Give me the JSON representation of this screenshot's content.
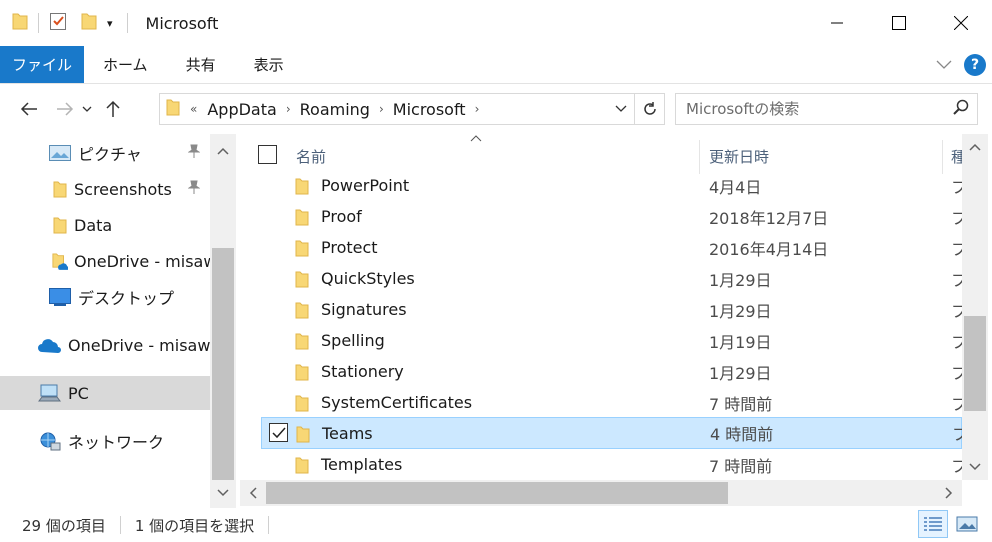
{
  "window": {
    "title": "Microsoft"
  },
  "ribbon": {
    "tabs": [
      "ファイル",
      "ホーム",
      "共有",
      "表示"
    ],
    "help_label": "?"
  },
  "address": {
    "overflow_marker": "«",
    "crumbs": [
      "AppData",
      "Roaming",
      "Microsoft"
    ]
  },
  "search": {
    "placeholder": "Microsoftの検索"
  },
  "nav": {
    "items": [
      {
        "label": "ピクチャ",
        "icon": "pictures-icon",
        "pinned": true
      },
      {
        "label": "Screenshots",
        "icon": "folder-icon",
        "pinned": true
      },
      {
        "label": "Data",
        "icon": "folder-icon",
        "pinned": false
      },
      {
        "label": "OneDrive - misawa",
        "icon": "onedrive-folder-icon",
        "pinned": false
      },
      {
        "label": "デスクトップ",
        "icon": "desktop-icon",
        "pinned": false
      },
      {
        "label": "OneDrive - misawa",
        "icon": "onedrive-cloud-icon",
        "pinned": false
      },
      {
        "label": "PC",
        "icon": "pc-icon",
        "pinned": false,
        "selected": true
      },
      {
        "label": "ネットワーク",
        "icon": "network-icon",
        "pinned": false
      }
    ]
  },
  "columns": {
    "name": "名前",
    "date": "更新日時",
    "type": "種"
  },
  "files": [
    {
      "name": "PowerPoint",
      "date": "4月4日",
      "type": "フ"
    },
    {
      "name": "Proof",
      "date": "2018年12月7日",
      "type": "フ"
    },
    {
      "name": "Protect",
      "date": "2016年4月14日",
      "type": "フ"
    },
    {
      "name": "QuickStyles",
      "date": "1月29日",
      "type": "フ"
    },
    {
      "name": "Signatures",
      "date": "1月29日",
      "type": "フ"
    },
    {
      "name": "Spelling",
      "date": "1月19日",
      "type": "フ"
    },
    {
      "name": "Stationery",
      "date": "1月29日",
      "type": "フ"
    },
    {
      "name": "SystemCertificates",
      "date": "7 時間前",
      "type": "フ"
    },
    {
      "name": "Teams",
      "date": "4 時間前",
      "type": "フ",
      "selected": true
    },
    {
      "name": "Templates",
      "date": "7 時間前",
      "type": "フ"
    }
  ],
  "status": {
    "count": "29 個の項目",
    "selected": "1 個の項目を選択"
  },
  "colors": {
    "accent": "#1979ca",
    "selection": "#cce8ff",
    "folder": "#f8d775"
  }
}
